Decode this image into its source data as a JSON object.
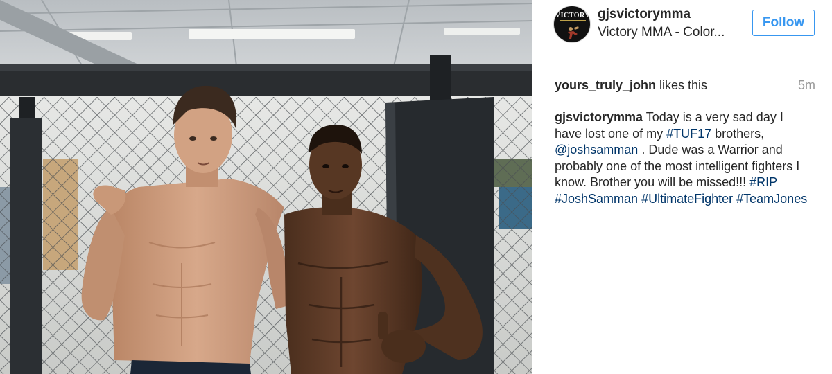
{
  "post": {
    "photo": {
      "colors": {
        "ceiling": "#c8cdd0",
        "cage_pad": "#262a2e",
        "skin_left": "#c99878",
        "skin_right": "#5a3a26"
      }
    },
    "header": {
      "avatar_text": "VICTORY",
      "username": "gjsvictorymma",
      "location": "Victory MMA - Color...",
      "follow_label": "Follow"
    },
    "likes": {
      "user": "yours_truly_john",
      "text": " likes this",
      "time": "5m"
    },
    "caption": {
      "user": "gjsvictorymma",
      "text_1": " Today is a very sad day I have lost one of my ",
      "tag_tuf17": "#TUF17",
      "text_2": " brothers, ",
      "mention": "@joshsamman",
      "text_3": " . Dude was a Warrior and probably one of the most intelligent fighters I know. Brother you will be missed!!! ",
      "tag_rip": "#RIP",
      "tag_josh": "#JoshSamman",
      "tag_uf": "#UltimateFighter",
      "tag_team": "#TeamJones"
    },
    "colors": {
      "link": "#003569",
      "follow_blue": "#3897f0",
      "meta_gray": "#999999",
      "text": "#262626"
    }
  }
}
